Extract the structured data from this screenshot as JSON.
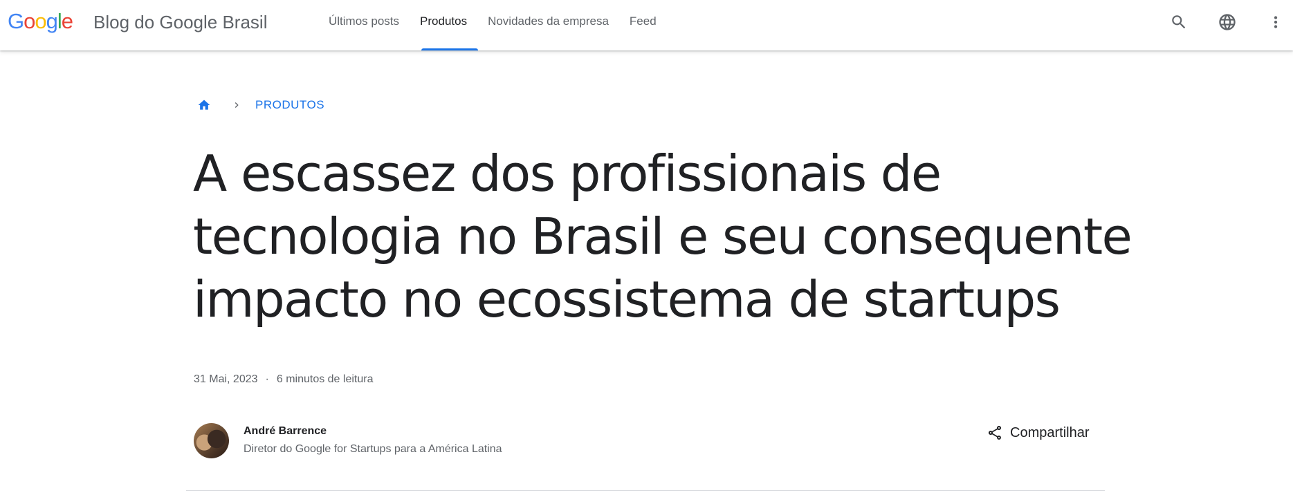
{
  "header": {
    "logo_letters": [
      {
        "char": "G",
        "color": "#4285F4"
      },
      {
        "char": "o",
        "color": "#EA4335"
      },
      {
        "char": "o",
        "color": "#FBBC05"
      },
      {
        "char": "g",
        "color": "#4285F4"
      },
      {
        "char": "l",
        "color": "#34A853"
      },
      {
        "char": "e",
        "color": "#EA4335"
      }
    ],
    "site_title": "Blog do Google Brasil",
    "nav": [
      {
        "label": "Últimos posts",
        "active": false
      },
      {
        "label": "Produtos",
        "active": true
      },
      {
        "label": "Novidades da empresa",
        "active": false
      },
      {
        "label": "Feed",
        "active": false
      }
    ],
    "icons": [
      "search-icon",
      "globe-icon",
      "more-vert-icon"
    ]
  },
  "breadcrumb": {
    "home_icon": "home-icon",
    "separator_icon": "chevron-right-icon",
    "section": "PRODUTOS"
  },
  "article": {
    "title": "A escassez dos profissionais de tecnologia no Brasil e seu consequente impacto no ecossistema de startups",
    "date": "31 Mai, 2023",
    "separator": "·",
    "reading_time": "6 minutos de leitura"
  },
  "author": {
    "name": "André Barrence",
    "role": "Diretor do Google for Startups para a América Latina"
  },
  "share": {
    "label": "Compartilhar",
    "icon": "share-icon"
  },
  "colors": {
    "accent": "#1a73e8",
    "text_primary": "#202124",
    "text_secondary": "#5f6368"
  }
}
